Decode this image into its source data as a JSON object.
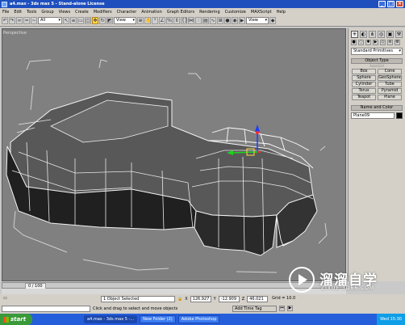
{
  "window": {
    "title": "a4.max - 3ds max 5 - Stand-alone License"
  },
  "menu": [
    "File",
    "Edit",
    "Tools",
    "Group",
    "Views",
    "Create",
    "Modifiers",
    "Character",
    "Animation",
    "Graph Editors",
    "Rendering",
    "Customize",
    "MAXScript",
    "Help"
  ],
  "toolbar": {
    "selection_filter": "All",
    "reference_coord": "View",
    "named_selection": "View"
  },
  "viewport": {
    "label": "Perspective"
  },
  "command_panel": {
    "category": "Standard Primitives",
    "object_type_header": "Object Type",
    "autogrid_label": "AutoGrid",
    "primitives": [
      "Box",
      "Cone",
      "Sphere",
      "GeoSphere",
      "Cylinder",
      "Tube",
      "Torus",
      "Pyramid",
      "Teapot",
      "Plane"
    ],
    "name_color_header": "Name and Color",
    "object_name": "Plane09",
    "object_color": "#000000"
  },
  "timeline": {
    "frame_display": "0 / 100"
  },
  "status": {
    "selection": "1 Object Selected",
    "x": "126.927",
    "y": "-12.909",
    "z": "46.021",
    "grid": "Grid = 10.0",
    "prompt": "Click and drag to select and move objects",
    "add_time_tag": "Add Time Tag"
  },
  "taskbar": {
    "start": "start",
    "apps": [
      "a4.max - 3ds max 5 -...",
      "New Folder (2)",
      "Adobe Photoshop"
    ],
    "clock": "Wed 15:30"
  },
  "watermark": {
    "title": "溜溜自学",
    "subtitle": "ZIXUE.3D66.COM"
  },
  "colors": {
    "title_bar": "#1e4fbd",
    "viewport_bg": "#808080",
    "active_border": "#ffd84a",
    "taskbar": "#245edb"
  }
}
